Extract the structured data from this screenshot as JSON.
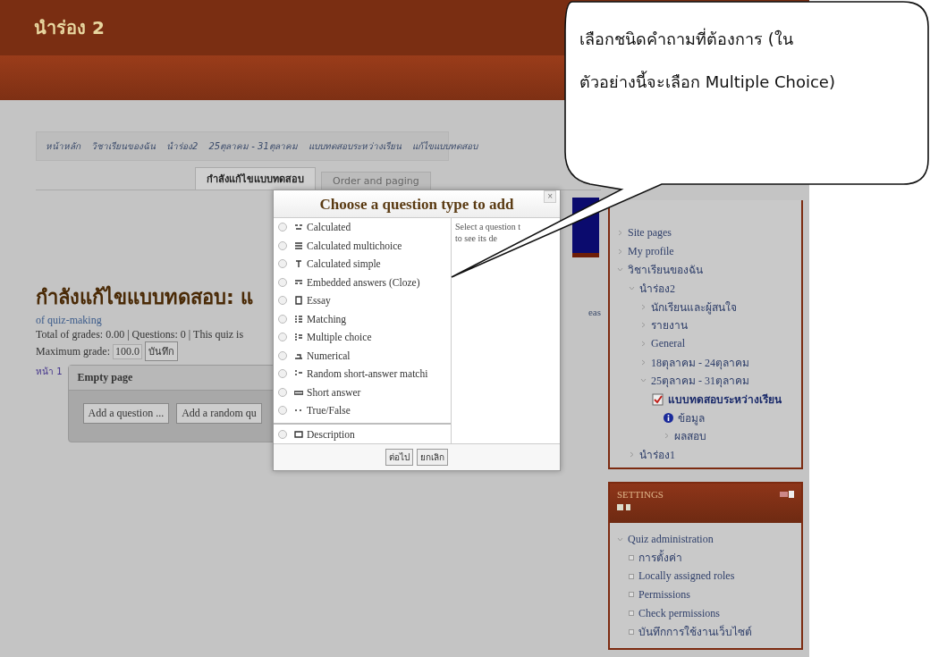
{
  "header": {
    "title": "นำร่อง 2"
  },
  "breadcrumb": [
    "หน้าหลัก",
    "วิชาเรียนของฉัน",
    "นำร่อง2",
    "25ตุลาคม - 31ตุลาคม",
    "แบบทดสอบระหว่างเรียน",
    "แก้ไขแบบทดสอบ"
  ],
  "tabs": [
    {
      "label": "กำลังแก้ไขแบบทดสอบ",
      "selected": true
    },
    {
      "label": "Order and paging",
      "selected": false
    }
  ],
  "quiz": {
    "heading": "กำลังแก้ไขแบบทดสอบ: แ",
    "subtitle": "of quiz-making",
    "totals": "Total of grades: 0.00 | Questions: 0 | This quiz is",
    "max_grade_label": "Maximum grade:",
    "max_grade_value": "100.0",
    "save_button": "บันทึก",
    "page_label": "หน้า 1",
    "page_title": "Empty page",
    "buttons": [
      "Add a question ...",
      "Add a random qu"
    ],
    "side_text": "eas"
  },
  "dialog": {
    "title": "Choose a question type to add",
    "close": "×",
    "help": [
      "Select a question t",
      "to see its de"
    ],
    "types": [
      {
        "label": "Calculated",
        "selected": false,
        "separated": false
      },
      {
        "label": "Calculated multichoice",
        "selected": false,
        "separated": false
      },
      {
        "label": "Calculated simple",
        "selected": false,
        "separated": false
      },
      {
        "label": "Embedded answers (Cloze)",
        "selected": false,
        "separated": false
      },
      {
        "label": "Essay",
        "selected": false,
        "separated": false
      },
      {
        "label": "Matching",
        "selected": false,
        "separated": false
      },
      {
        "label": "Multiple choice",
        "selected": false,
        "separated": false
      },
      {
        "label": "Numerical",
        "selected": false,
        "separated": false
      },
      {
        "label": "Random short-answer matchi",
        "selected": false,
        "separated": false
      },
      {
        "label": "Short answer",
        "selected": false,
        "separated": false
      },
      {
        "label": "True/False",
        "selected": false,
        "separated": false
      },
      {
        "label": "Description",
        "selected": false,
        "separated": true
      }
    ],
    "buttons": [
      "ต่อไป",
      "ยกเลิก"
    ]
  },
  "navigation": {
    "items": [
      {
        "label": "Site pages",
        "kind": "node",
        "expanded": false
      },
      {
        "label": "My profile",
        "kind": "node",
        "expanded": false
      },
      {
        "label": "วิชาเรียนของฉัน",
        "kind": "node",
        "expanded": true,
        "children": [
          {
            "label": "นำร่อง2",
            "kind": "node",
            "expanded": true,
            "children": [
              {
                "label": "นักเรียนและผู้สนใจ",
                "kind": "node",
                "expanded": false
              },
              {
                "label": "รายงาน",
                "kind": "node",
                "expanded": false
              },
              {
                "label": "General",
                "kind": "node",
                "expanded": false
              },
              {
                "label": "18ตุลาคม - 24ตุลาคม",
                "kind": "node",
                "expanded": false
              },
              {
                "label": "25ตุลาคม - 31ตุลาคม",
                "kind": "node",
                "expanded": true,
                "children": [
                  {
                    "label": "แบบทดสอบระหว่างเรียน",
                    "kind": "quiz",
                    "children": [
                      {
                        "label": "ข้อมูล",
                        "kind": "info"
                      },
                      {
                        "label": "ผลสอบ",
                        "kind": "node",
                        "expanded": false
                      }
                    ]
                  }
                ]
              }
            ]
          },
          {
            "label": "นำร่อง1",
            "kind": "node",
            "expanded": false
          }
        ]
      }
    ]
  },
  "settings": {
    "title": "SETTINGS",
    "items": [
      {
        "label": "Quiz administration",
        "kind": "node",
        "expanded": true,
        "children": [
          {
            "label": "การตั้งค่า",
            "kind": "setting"
          },
          {
            "label": "Locally assigned roles",
            "kind": "setting"
          },
          {
            "label": "Permissions",
            "kind": "setting"
          },
          {
            "label": "Check permissions",
            "kind": "setting"
          },
          {
            "label": "บันทึกการใช้งานเว็บไซต์",
            "kind": "setting"
          }
        ]
      }
    ]
  },
  "callout": {
    "text": "เลือกชนิดคำถามที่ต้องการ (ในตัวอย่างนี้จะเลือก Multiple Choice)"
  }
}
